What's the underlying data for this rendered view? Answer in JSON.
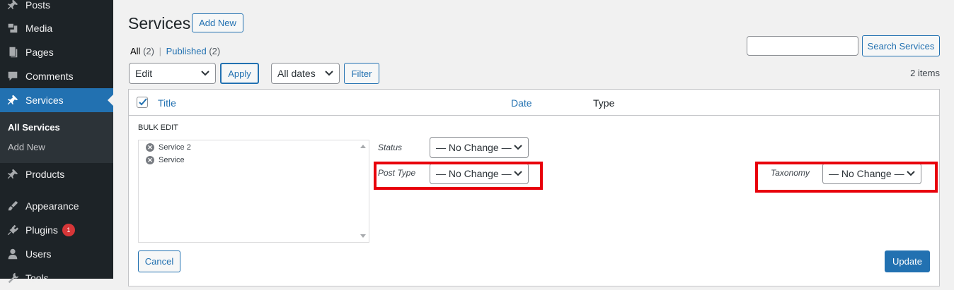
{
  "sidebar": {
    "items": [
      {
        "label": "Posts",
        "icon": "pin-icon"
      },
      {
        "label": "Media",
        "icon": "media-icon"
      },
      {
        "label": "Pages",
        "icon": "pages-icon"
      },
      {
        "label": "Comments",
        "icon": "comment-icon"
      },
      {
        "label": "Services",
        "icon": "pin-icon"
      },
      {
        "label": "Products",
        "icon": "pin-icon"
      },
      {
        "label": "Appearance",
        "icon": "brush-icon"
      },
      {
        "label": "Plugins",
        "icon": "plugin-icon",
        "badge": "1"
      },
      {
        "label": "Users",
        "icon": "user-icon"
      },
      {
        "label": "Tools",
        "icon": "tools-icon"
      }
    ],
    "submenu": [
      "All Services",
      "Add New"
    ]
  },
  "header": {
    "title": "Services",
    "add_new": "Add New",
    "filter_all": "All",
    "filter_all_count": "(2)",
    "separator": "|",
    "filter_published": "Published",
    "filter_published_count": "(2)"
  },
  "search": {
    "value": "",
    "button": "Search Services"
  },
  "toolbar": {
    "bulk_action": "Edit",
    "apply": "Apply",
    "dates": "All dates",
    "filter": "Filter",
    "items_count": "2 items"
  },
  "table": {
    "columns": [
      "Title",
      "Date",
      "Type"
    ]
  },
  "bulk_edit": {
    "heading": "BULK EDIT",
    "titles": [
      "Service 2",
      "Service"
    ],
    "status_label": "Status",
    "status_value": "— No Change —",
    "post_type_label": "Post Type",
    "post_type_value": "— No Change —",
    "taxonomy_label": "Taxonomy",
    "taxonomy_value": "— No Change —",
    "cancel": "Cancel",
    "update": "Update"
  },
  "colors": {
    "accent": "#2271b1",
    "sidebar_bg": "#1d2327",
    "highlight": "#e8000b"
  }
}
